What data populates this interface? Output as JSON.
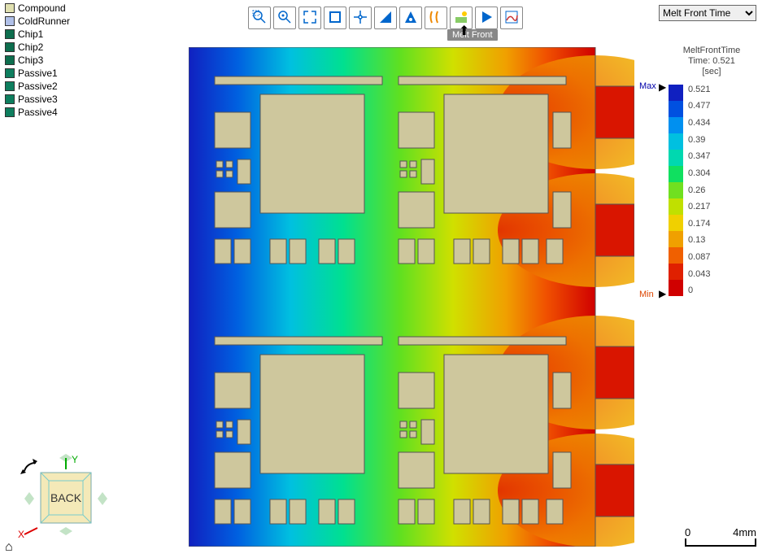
{
  "model_tree": [
    {
      "label": "Compound",
      "color": "#e0e0b0"
    },
    {
      "label": "ColdRunner",
      "color": "#b0c0e8"
    },
    {
      "label": "Chip1",
      "color": "#0e6e4e"
    },
    {
      "label": "Chip2",
      "color": "#0e6e4e"
    },
    {
      "label": "Chip3",
      "color": "#0e6e4e"
    },
    {
      "label": "Passive1",
      "color": "#0e7e5e"
    },
    {
      "label": "Passive2",
      "color": "#0e7e5e"
    },
    {
      "label": "Passive3",
      "color": "#0e7e5e"
    },
    {
      "label": "Passive4",
      "color": "#0e7e5e"
    }
  ],
  "toolbar": {
    "buttons": [
      {
        "name": "zoom-box-icon"
      },
      {
        "name": "zoom-target-icon"
      },
      {
        "name": "fit-icon"
      },
      {
        "name": "window-icon"
      },
      {
        "name": "pan-icon"
      },
      {
        "name": "measure-icon"
      },
      {
        "name": "probe-icon"
      },
      {
        "name": "section-icon"
      },
      {
        "name": "iso-icon"
      },
      {
        "name": "play-icon"
      },
      {
        "name": "chart-icon"
      }
    ],
    "tooltip": "Melt Front"
  },
  "result_select": {
    "value": "Melt Front Time",
    "options": [
      "Melt Front Time"
    ]
  },
  "colorbar": {
    "title_line1": "MeltFrontTime",
    "title_line2": "Time: 0.521",
    "title_line3": "[sec]",
    "max_label": "Max",
    "min_label": "Min",
    "colors": [
      "#1020c0",
      "#0050e0",
      "#0090f0",
      "#00c0e0",
      "#00d8b0",
      "#10e060",
      "#70e020",
      "#c0e000",
      "#f0d000",
      "#f0a000",
      "#f06000",
      "#e02000",
      "#d00000"
    ],
    "values": [
      "0.521",
      "0.477",
      "0.434",
      "0.39",
      "0.347",
      "0.304",
      "0.26",
      "0.217",
      "0.174",
      "0.13",
      "0.087",
      "0.043",
      "0"
    ]
  },
  "scalebar": {
    "start": "0",
    "end": "4mm"
  },
  "navcube": {
    "face": "BACK",
    "x": "X",
    "y": "Y"
  },
  "chart_data": {
    "type": "heatmap",
    "title": "MeltFrontTime",
    "time_sec": 0.521,
    "unit": "sec",
    "range": [
      0,
      0.521
    ],
    "description": "Mold-filling melt-front-time contour on a rectangular compound cavity containing chip and passive component cutouts. Four red gate tabs on the right edge indicate injection locations (time≈0). Melt front time increases right→left, reaching ≈0.52 s (blue) along the left edge.",
    "gates": 4,
    "gradient_direction": "right-to-left",
    "colorbar_values": [
      0.521,
      0.477,
      0.434,
      0.39,
      0.347,
      0.304,
      0.26,
      0.217,
      0.174,
      0.13,
      0.087,
      0.043,
      0
    ]
  }
}
